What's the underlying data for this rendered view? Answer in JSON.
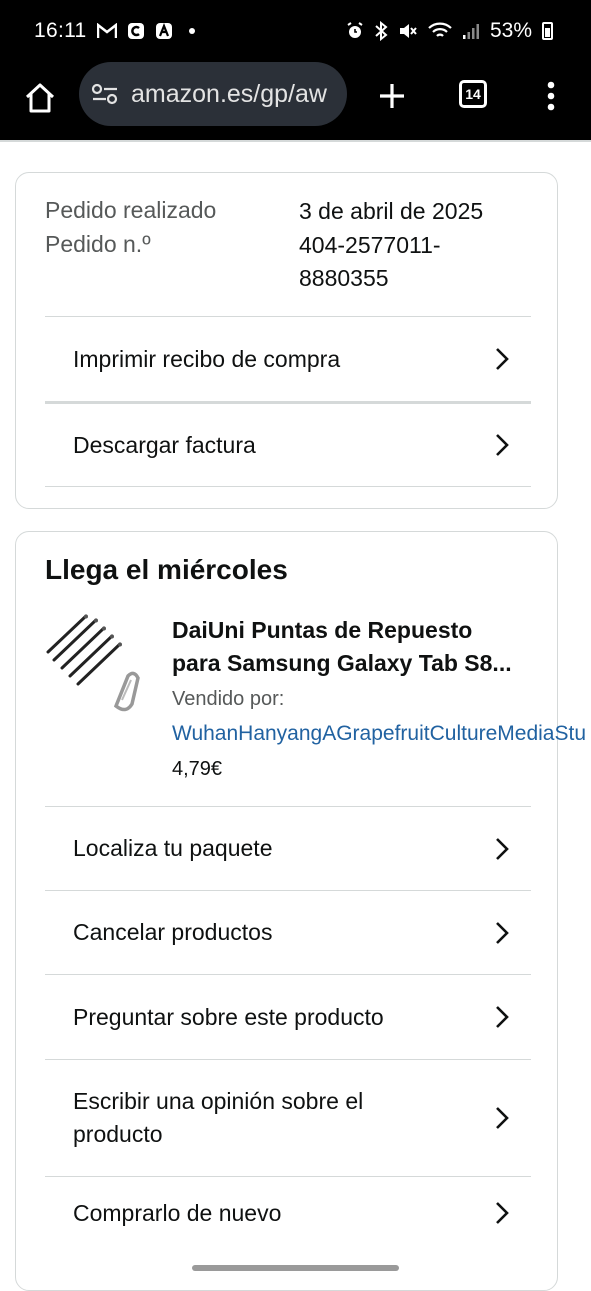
{
  "status_bar": {
    "time": "16:11",
    "battery": "53%",
    "left_icons": [
      "gmail-icon",
      "c-app-icon",
      "a-app-icon",
      "dot-icon"
    ],
    "right_icons": [
      "alarm-icon",
      "bluetooth-icon",
      "mute-icon",
      "wifi-icon",
      "signal-icon",
      "battery-icon"
    ]
  },
  "browser": {
    "url": "amazon.es/gp/aw",
    "tab_count": "14"
  },
  "order": {
    "placed_label": "Pedido realizado",
    "placed_value": "3 de abril de 2025",
    "number_label": "Pedido n.º",
    "number_value_line1": "404-2577011-",
    "number_value_line2": "8880355",
    "actions": [
      "Imprimir recibo de compra",
      "Descargar factura"
    ]
  },
  "shipment": {
    "heading": "Llega el miércoles",
    "product": {
      "title_line1": "DaiUni Puntas de Repuesto",
      "title_line2": "para Samsung Galaxy Tab S8...",
      "sold_by_label": "Vendido por:",
      "seller": "WuhanHanyangAGrapefruitCultureMediaStu",
      "price": "4,79€"
    },
    "actions": [
      "Localiza tu paquete",
      "Cancelar productos",
      "Preguntar sobre este producto",
      "Escribir una opinión sobre el producto",
      "Comprarlo de nuevo"
    ]
  }
}
